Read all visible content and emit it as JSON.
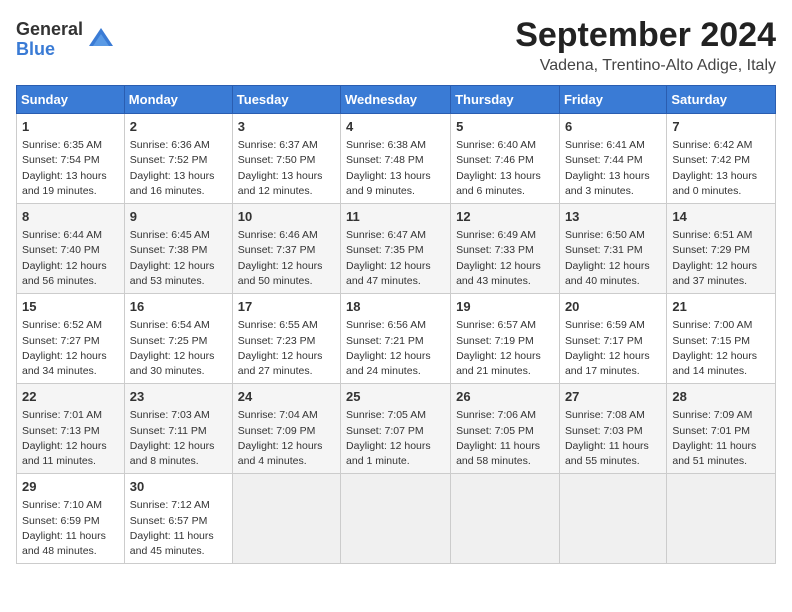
{
  "header": {
    "logo_general": "General",
    "logo_blue": "Blue",
    "month_title": "September 2024",
    "location": "Vadena, Trentino-Alto Adige, Italy"
  },
  "weekdays": [
    "Sunday",
    "Monday",
    "Tuesday",
    "Wednesday",
    "Thursday",
    "Friday",
    "Saturday"
  ],
  "weeks": [
    [
      {
        "day": "1",
        "sunrise": "6:35 AM",
        "sunset": "7:54 PM",
        "daylight": "13 hours and 19 minutes."
      },
      {
        "day": "2",
        "sunrise": "6:36 AM",
        "sunset": "7:52 PM",
        "daylight": "13 hours and 16 minutes."
      },
      {
        "day": "3",
        "sunrise": "6:37 AM",
        "sunset": "7:50 PM",
        "daylight": "13 hours and 12 minutes."
      },
      {
        "day": "4",
        "sunrise": "6:38 AM",
        "sunset": "7:48 PM",
        "daylight": "13 hours and 9 minutes."
      },
      {
        "day": "5",
        "sunrise": "6:40 AM",
        "sunset": "7:46 PM",
        "daylight": "13 hours and 6 minutes."
      },
      {
        "day": "6",
        "sunrise": "6:41 AM",
        "sunset": "7:44 PM",
        "daylight": "13 hours and 3 minutes."
      },
      {
        "day": "7",
        "sunrise": "6:42 AM",
        "sunset": "7:42 PM",
        "daylight": "13 hours and 0 minutes."
      }
    ],
    [
      {
        "day": "8",
        "sunrise": "6:44 AM",
        "sunset": "7:40 PM",
        "daylight": "12 hours and 56 minutes."
      },
      {
        "day": "9",
        "sunrise": "6:45 AM",
        "sunset": "7:38 PM",
        "daylight": "12 hours and 53 minutes."
      },
      {
        "day": "10",
        "sunrise": "6:46 AM",
        "sunset": "7:37 PM",
        "daylight": "12 hours and 50 minutes."
      },
      {
        "day": "11",
        "sunrise": "6:47 AM",
        "sunset": "7:35 PM",
        "daylight": "12 hours and 47 minutes."
      },
      {
        "day": "12",
        "sunrise": "6:49 AM",
        "sunset": "7:33 PM",
        "daylight": "12 hours and 43 minutes."
      },
      {
        "day": "13",
        "sunrise": "6:50 AM",
        "sunset": "7:31 PM",
        "daylight": "12 hours and 40 minutes."
      },
      {
        "day": "14",
        "sunrise": "6:51 AM",
        "sunset": "7:29 PM",
        "daylight": "12 hours and 37 minutes."
      }
    ],
    [
      {
        "day": "15",
        "sunrise": "6:52 AM",
        "sunset": "7:27 PM",
        "daylight": "12 hours and 34 minutes."
      },
      {
        "day": "16",
        "sunrise": "6:54 AM",
        "sunset": "7:25 PM",
        "daylight": "12 hours and 30 minutes."
      },
      {
        "day": "17",
        "sunrise": "6:55 AM",
        "sunset": "7:23 PM",
        "daylight": "12 hours and 27 minutes."
      },
      {
        "day": "18",
        "sunrise": "6:56 AM",
        "sunset": "7:21 PM",
        "daylight": "12 hours and 24 minutes."
      },
      {
        "day": "19",
        "sunrise": "6:57 AM",
        "sunset": "7:19 PM",
        "daylight": "12 hours and 21 minutes."
      },
      {
        "day": "20",
        "sunrise": "6:59 AM",
        "sunset": "7:17 PM",
        "daylight": "12 hours and 17 minutes."
      },
      {
        "day": "21",
        "sunrise": "7:00 AM",
        "sunset": "7:15 PM",
        "daylight": "12 hours and 14 minutes."
      }
    ],
    [
      {
        "day": "22",
        "sunrise": "7:01 AM",
        "sunset": "7:13 PM",
        "daylight": "12 hours and 11 minutes."
      },
      {
        "day": "23",
        "sunrise": "7:03 AM",
        "sunset": "7:11 PM",
        "daylight": "12 hours and 8 minutes."
      },
      {
        "day": "24",
        "sunrise": "7:04 AM",
        "sunset": "7:09 PM",
        "daylight": "12 hours and 4 minutes."
      },
      {
        "day": "25",
        "sunrise": "7:05 AM",
        "sunset": "7:07 PM",
        "daylight": "12 hours and 1 minute."
      },
      {
        "day": "26",
        "sunrise": "7:06 AM",
        "sunset": "7:05 PM",
        "daylight": "11 hours and 58 minutes."
      },
      {
        "day": "27",
        "sunrise": "7:08 AM",
        "sunset": "7:03 PM",
        "daylight": "11 hours and 55 minutes."
      },
      {
        "day": "28",
        "sunrise": "7:09 AM",
        "sunset": "7:01 PM",
        "daylight": "11 hours and 51 minutes."
      }
    ],
    [
      {
        "day": "29",
        "sunrise": "7:10 AM",
        "sunset": "6:59 PM",
        "daylight": "11 hours and 48 minutes."
      },
      {
        "day": "30",
        "sunrise": "7:12 AM",
        "sunset": "6:57 PM",
        "daylight": "11 hours and 45 minutes."
      },
      null,
      null,
      null,
      null,
      null
    ]
  ],
  "labels": {
    "sunrise": "Sunrise:",
    "sunset": "Sunset:",
    "daylight": "Daylight:"
  }
}
